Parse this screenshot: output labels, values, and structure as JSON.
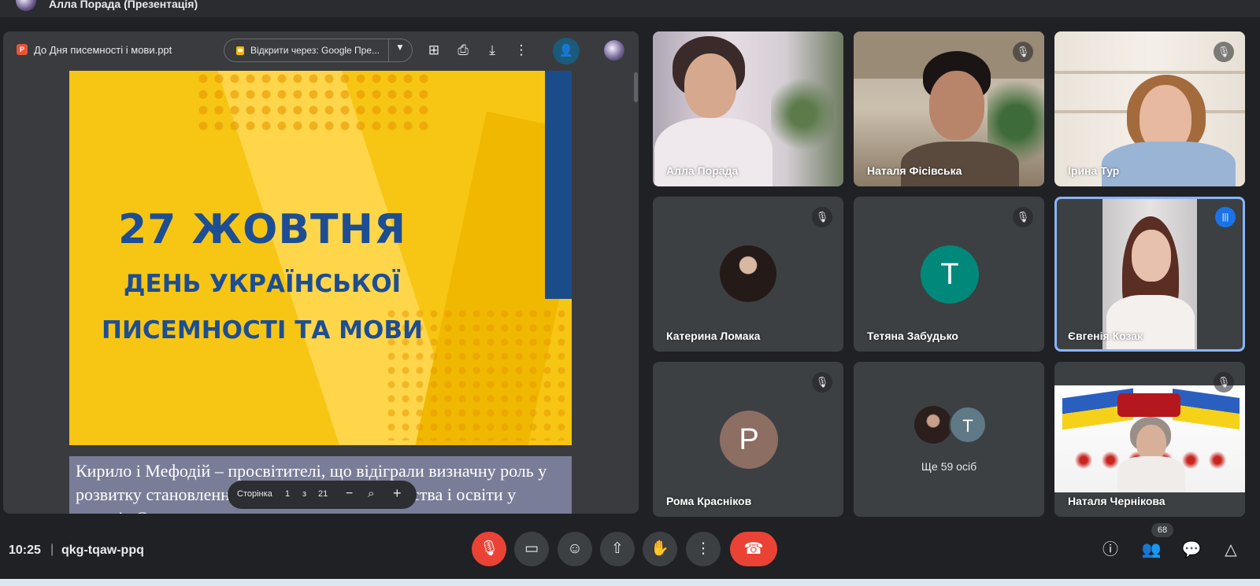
{
  "presenter_strip": {
    "label": "Алла Порада (Презентація)"
  },
  "presentation": {
    "file_name": "До Дня писемності і мови.ppt",
    "open_with_label": "Відкрити через: Google Пре...",
    "slide": {
      "line1": "27 ЖОВТНЯ",
      "line2": "ДЕНЬ УКРАЇНСЬКОЇ",
      "line3": "ПИСЕМНОСТІ ТА МОВИ"
    },
    "next_slide_text": "Кирило і Мефодій  – просвітителі, що відіграли визначну роль у розвитку становлення слов’янського письменства і освіти у народів Європи",
    "page_control": {
      "label": "Сторінка",
      "current": "1",
      "of": "з",
      "total": "21"
    }
  },
  "participants": [
    {
      "name": "Алла Порада",
      "muted": false
    },
    {
      "name": "Наталя Фісівська",
      "muted": true
    },
    {
      "name": "Ірина Тур",
      "muted": true
    },
    {
      "name": "Катерина Ломака",
      "muted": true
    },
    {
      "name": "Тетяна Забудько",
      "muted": true,
      "initial": "T",
      "color": "#00897b"
    },
    {
      "name": "Євгенія Козак",
      "speaking": true
    },
    {
      "name": "Рома Красніков",
      "muted": true,
      "initial": "P",
      "color": "#8d6e63"
    },
    {
      "name": "Наталя Чернікова",
      "muted": true
    }
  ],
  "more_tile": {
    "label": "Ще 59 осіб",
    "initial": "T"
  },
  "bottom_bar": {
    "time": "10:25",
    "separator": "|",
    "meeting_code": "qkg-tqaw-ppq",
    "people_count": "68"
  },
  "colors": {
    "background": "#202124",
    "tile": "#3c4043",
    "danger": "#ea4335",
    "active_speaker": "#8ab4f8"
  }
}
